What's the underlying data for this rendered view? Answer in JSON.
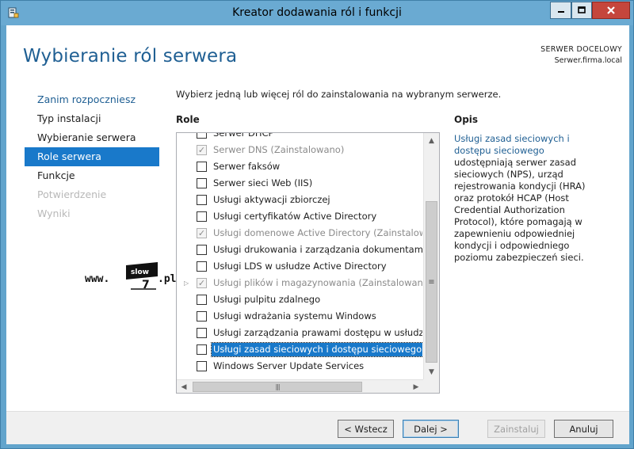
{
  "window": {
    "title": "Kreator dodawania ról i funkcji",
    "minimize_glyph": "—",
    "maximize_glyph": "□",
    "close_glyph": "✕"
  },
  "header": {
    "page_title": "Wybieranie ról serwera",
    "server_label": "SERWER DOCELOWY",
    "server_name": "Serwer.firma.local"
  },
  "nav": {
    "items": [
      {
        "label": "Zanim rozpoczniesz",
        "state": "link"
      },
      {
        "label": "Typ instalacji",
        "state": "normal"
      },
      {
        "label": "Wybieranie serwera",
        "state": "normal"
      },
      {
        "label": "Role serwera",
        "state": "active"
      },
      {
        "label": "Funkcje",
        "state": "normal"
      },
      {
        "label": "Potwierdzenie",
        "state": "disabled"
      },
      {
        "label": "Wyniki",
        "state": "disabled"
      }
    ]
  },
  "main": {
    "instruction": "Wybierz jedną lub więcej ról do zainstalowania na wybranym serwerze.",
    "roles_header": "Role",
    "roles": [
      {
        "label": "Serwer DHCP",
        "checked": false,
        "installed": false
      },
      {
        "label": "Serwer DNS (Zainstalowano)",
        "checked": true,
        "installed": true
      },
      {
        "label": "Serwer faksów",
        "checked": false,
        "installed": false
      },
      {
        "label": "Serwer sieci Web (IIS)",
        "checked": false,
        "installed": false
      },
      {
        "label": "Usługi aktywacji zbiorczej",
        "checked": false,
        "installed": false
      },
      {
        "label": "Usługi certyfikatów Active Directory",
        "checked": false,
        "installed": false
      },
      {
        "label": "Usługi domenowe Active Directory (Zainstalowano)",
        "checked": true,
        "installed": true
      },
      {
        "label": "Usługi drukowania i zarządzania dokumentami",
        "checked": false,
        "installed": false
      },
      {
        "label": "Usługi LDS w usłudze Active Directory",
        "checked": false,
        "installed": false
      },
      {
        "label": "Usługi plików i magazynowania (Zainstalowano)",
        "checked": true,
        "installed": true,
        "expandable": true
      },
      {
        "label": "Usługi pulpitu zdalnego",
        "checked": false,
        "installed": false
      },
      {
        "label": "Usługi wdrażania systemu Windows",
        "checked": false,
        "installed": false
      },
      {
        "label": "Usługi zarządzania prawami dostępu w usłudze Active Directory",
        "checked": false,
        "installed": false
      },
      {
        "label": "Usługi zasad sieciowych i dostępu sieciowego",
        "checked": false,
        "installed": false,
        "selected": true
      },
      {
        "label": "Windows Server Update Services",
        "checked": false,
        "installed": false
      }
    ],
    "description_header": "Opis",
    "description_link": "Usługi zasad sieciowych i dostępu sieciowego",
    "description_text": " udostępniają serwer zasad sieciowych (NPS), urząd rejestrowania kondycji (HRA) oraz protokół HCAP (Host Credential Authorization Protocol), które pomagają w zapewnieniu odpowiedniej kondycji i odpowiedniego poziomu zabezpieczeń sieci."
  },
  "watermark": {
    "prefix": "www.",
    "word": "slow",
    "digit": "7",
    "suffix": ".pl"
  },
  "footer": {
    "back_label": "< Wstecz",
    "next_label": "Dalej >",
    "install_label": "Zainstaluj",
    "cancel_label": "Anuluj"
  },
  "colors": {
    "accent": "#1979ca",
    "heading": "#1f5f93",
    "frame": "#62a4cc",
    "close": "#c5463c"
  }
}
